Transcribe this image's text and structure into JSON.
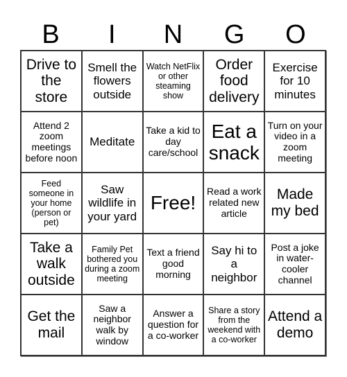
{
  "header": {
    "letters": [
      "B",
      "I",
      "N",
      "G",
      "O"
    ]
  },
  "cells": [
    [
      "Drive to the store",
      "Smell the flowers outside",
      "Watch NetFlix or other steaming show",
      "Order food delivery",
      "Exercise for 10 minutes"
    ],
    [
      "Attend 2 zoom meetings before noon",
      "Meditate",
      "Take a kid to day care/school",
      "Eat a snack",
      "Turn on your video in a zoom meeting"
    ],
    [
      "Feed someone in your home (person or pet)",
      "Saw wildlife in your yard",
      "Free!",
      "Read a work related new article",
      "Made my bed"
    ],
    [
      "Take a walk outside",
      "Family Pet bothered you during a zoom meeting",
      "Text a friend good morning",
      "Say hi to a neighbor",
      "Post a joke in water-cooler channel"
    ],
    [
      "Get the mail",
      "Saw a neighbor walk by window",
      "Answer a question for a co-worker",
      "Share a story from the weekend with a co-worker",
      "Attend a demo"
    ]
  ]
}
